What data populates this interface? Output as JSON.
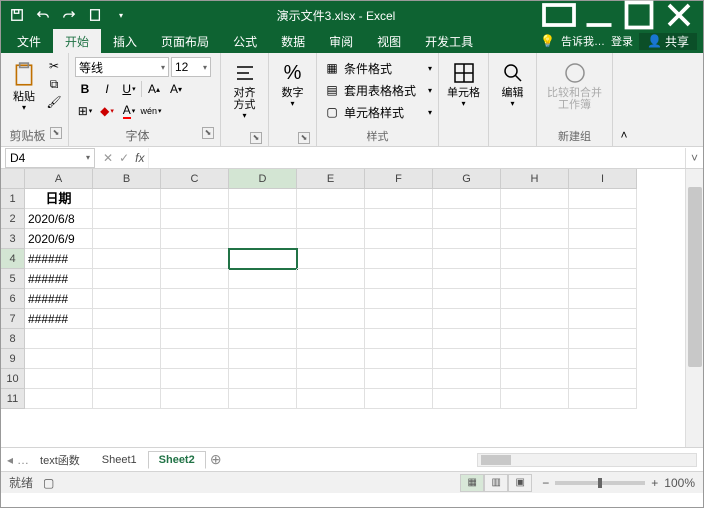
{
  "title": "演示文件3.xlsx - Excel",
  "menutabs": [
    "文件",
    "开始",
    "插入",
    "页面布局",
    "公式",
    "数据",
    "审阅",
    "视图",
    "开发工具"
  ],
  "active_tab": 1,
  "tell_me": "告诉我…",
  "login": "登录",
  "share": "共享",
  "ribbon": {
    "clipboard": {
      "paste": "粘贴",
      "label": "剪贴板"
    },
    "font": {
      "name": "等线",
      "size": "12",
      "label": "字体"
    },
    "align": {
      "btn": "对齐方式",
      "label": ""
    },
    "number": {
      "btn": "数字",
      "label": ""
    },
    "styles": {
      "cond": "条件格式",
      "table": "套用表格格式",
      "cell": "单元格样式",
      "label": "样式"
    },
    "cells": {
      "btn": "单元格",
      "label": ""
    },
    "edit": {
      "btn": "编辑",
      "label": ""
    },
    "newgrp": {
      "btn": "比较和合并工作簿",
      "label": "新建组"
    }
  },
  "namebox": "D4",
  "columns": [
    "A",
    "B",
    "C",
    "D",
    "E",
    "F",
    "G",
    "H",
    "I"
  ],
  "rows": [
    1,
    2,
    3,
    4,
    5,
    6,
    7,
    8,
    9,
    10,
    11
  ],
  "cells": {
    "A1": "日期",
    "A2": "2020/6/8",
    "A3": "2020/6/9",
    "A4": "######",
    "A5": "######",
    "A6": "######",
    "A7": "######"
  },
  "selected": "D4",
  "sheet_tabs": [
    "text函数",
    "Sheet1",
    "Sheet2"
  ],
  "active_sheet": 2,
  "status": "就绪",
  "rec": "",
  "zoom": "100%"
}
